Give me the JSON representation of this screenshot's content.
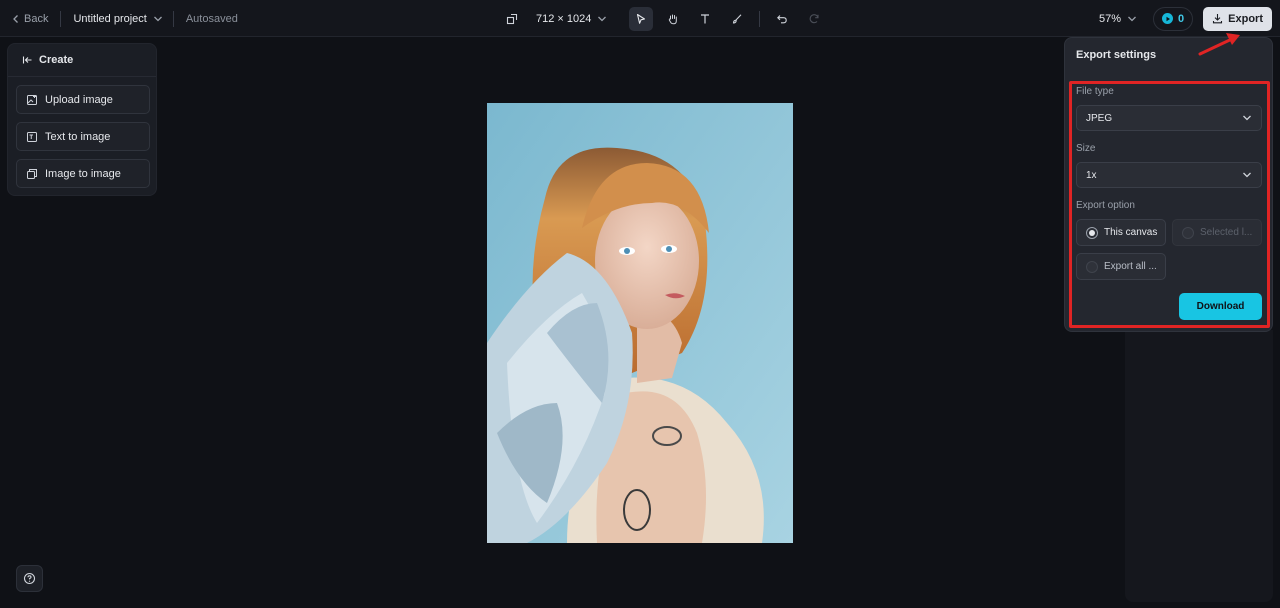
{
  "topbar": {
    "back_label": "Back",
    "project_name": "Untitled project",
    "autosaved": "Autosaved",
    "canvas_size": "712 × 1024",
    "zoom": "57%",
    "credits": "0",
    "export_label": "Export"
  },
  "create_panel": {
    "title": "Create",
    "items": [
      {
        "label": "Upload image",
        "icon": "upload-image-icon"
      },
      {
        "label": "Text to image",
        "icon": "text-to-image-icon"
      },
      {
        "label": "Image to image",
        "icon": "image-to-image-icon"
      }
    ]
  },
  "export_settings": {
    "title": "Export settings",
    "file_type_label": "File type",
    "file_type_value": "JPEG",
    "size_label": "Size",
    "size_value": "1x",
    "export_option_label": "Export option",
    "options": [
      {
        "label": "This canvas",
        "selected": true,
        "enabled": true
      },
      {
        "label": "Selected l...",
        "selected": false,
        "enabled": false
      },
      {
        "label": "Export all ...",
        "selected": false,
        "enabled": true
      }
    ],
    "download_label": "Download"
  },
  "colors": {
    "accent": "#18c5e3",
    "highlight": "#e02424",
    "background": "#0f1116"
  }
}
